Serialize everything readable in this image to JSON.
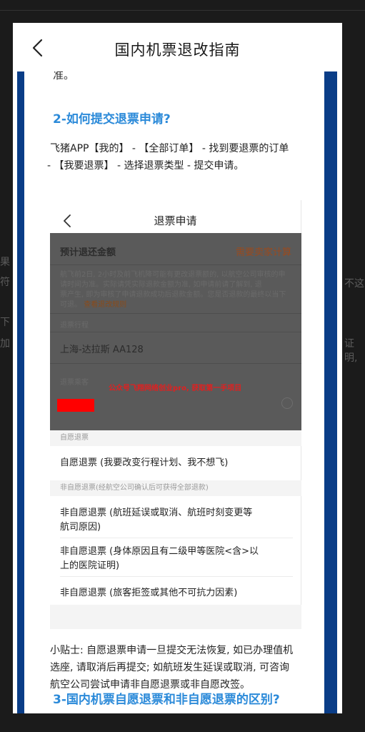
{
  "background_fragments": {
    "left_1": "果",
    "left_2": "符",
    "left_3": "下",
    "left_4": "加",
    "right_1": "不这",
    "right_2": "证明,"
  },
  "nav": {
    "title": "国内机票退改指南",
    "back_icon": "chevron-left-icon"
  },
  "article": {
    "cut_line": "准。",
    "heading_2": "2-如何提交退票申请?",
    "steps_line1": "飞猪APP【我的】 - 【全部订单】 - 找到要退票的订单",
    "steps_line2": "- 【我要退票】 - 选择退票类型 - 提交申请。",
    "tip_line1": "小贴士: 自愿退票申请一旦提交无法恢复, 如已办理值机",
    "tip_line2": "选座, 请取消后再提交; 如航班发生延误或取消, 可咨询",
    "tip_line3": "航空公司尝试申请非自愿退票或非自愿改签。",
    "heading_3": "3-国内机票自愿退票和非自愿退票的区别?"
  },
  "screenshot": {
    "title": "退票申请",
    "back_icon": "chevron-left-icon",
    "refund_label": "预计退还金额",
    "refund_value": "需要卖家计算",
    "notice_line1": "航飞前2日, 2小时及前飞机降可能有更改退票额的, 以航空公司审核的申",
    "notice_line2": "请时间为准。实际请凭实际退款金额为准, 如申请前请了解到, 退",
    "notice_line3": "票产生, 即为审核了申请退款成功后退款金额。您是否退款的最终以当下",
    "notice_line4": "可退。",
    "notice_link": "查看退改规则",
    "route_label": "退票行程",
    "route_value": "上海-达拉斯 AA128",
    "passenger_label": "退票乘客",
    "watermark": "公众号飞翔网络创业pro, 获取第一手项目",
    "section_voluntary": "自愿退票",
    "item_voluntary": "自愿退票 (我要改变行程计划、我不想飞)",
    "section_involuntary": "非自愿退票(经航空公司确认后可获得全部退款)",
    "item_inv_1_line1": "非自愿退票 (航班延误或取消、航班时刻变更等",
    "item_inv_1_line2": "航司原因)",
    "item_inv_2_line1": "非自愿退票 (身体原因且有二级甲等医院<含>以",
    "item_inv_2_line2": "上的医院证明)",
    "item_inv_3": "非自愿退票 (旅客拒签或其他不可抗力因素)"
  },
  "colors": {
    "border_blue": "#0a3d87",
    "heading_blue": "#2b8ad9",
    "refund_orange": "#9a4a1e",
    "watermark_red": "#e02020"
  }
}
